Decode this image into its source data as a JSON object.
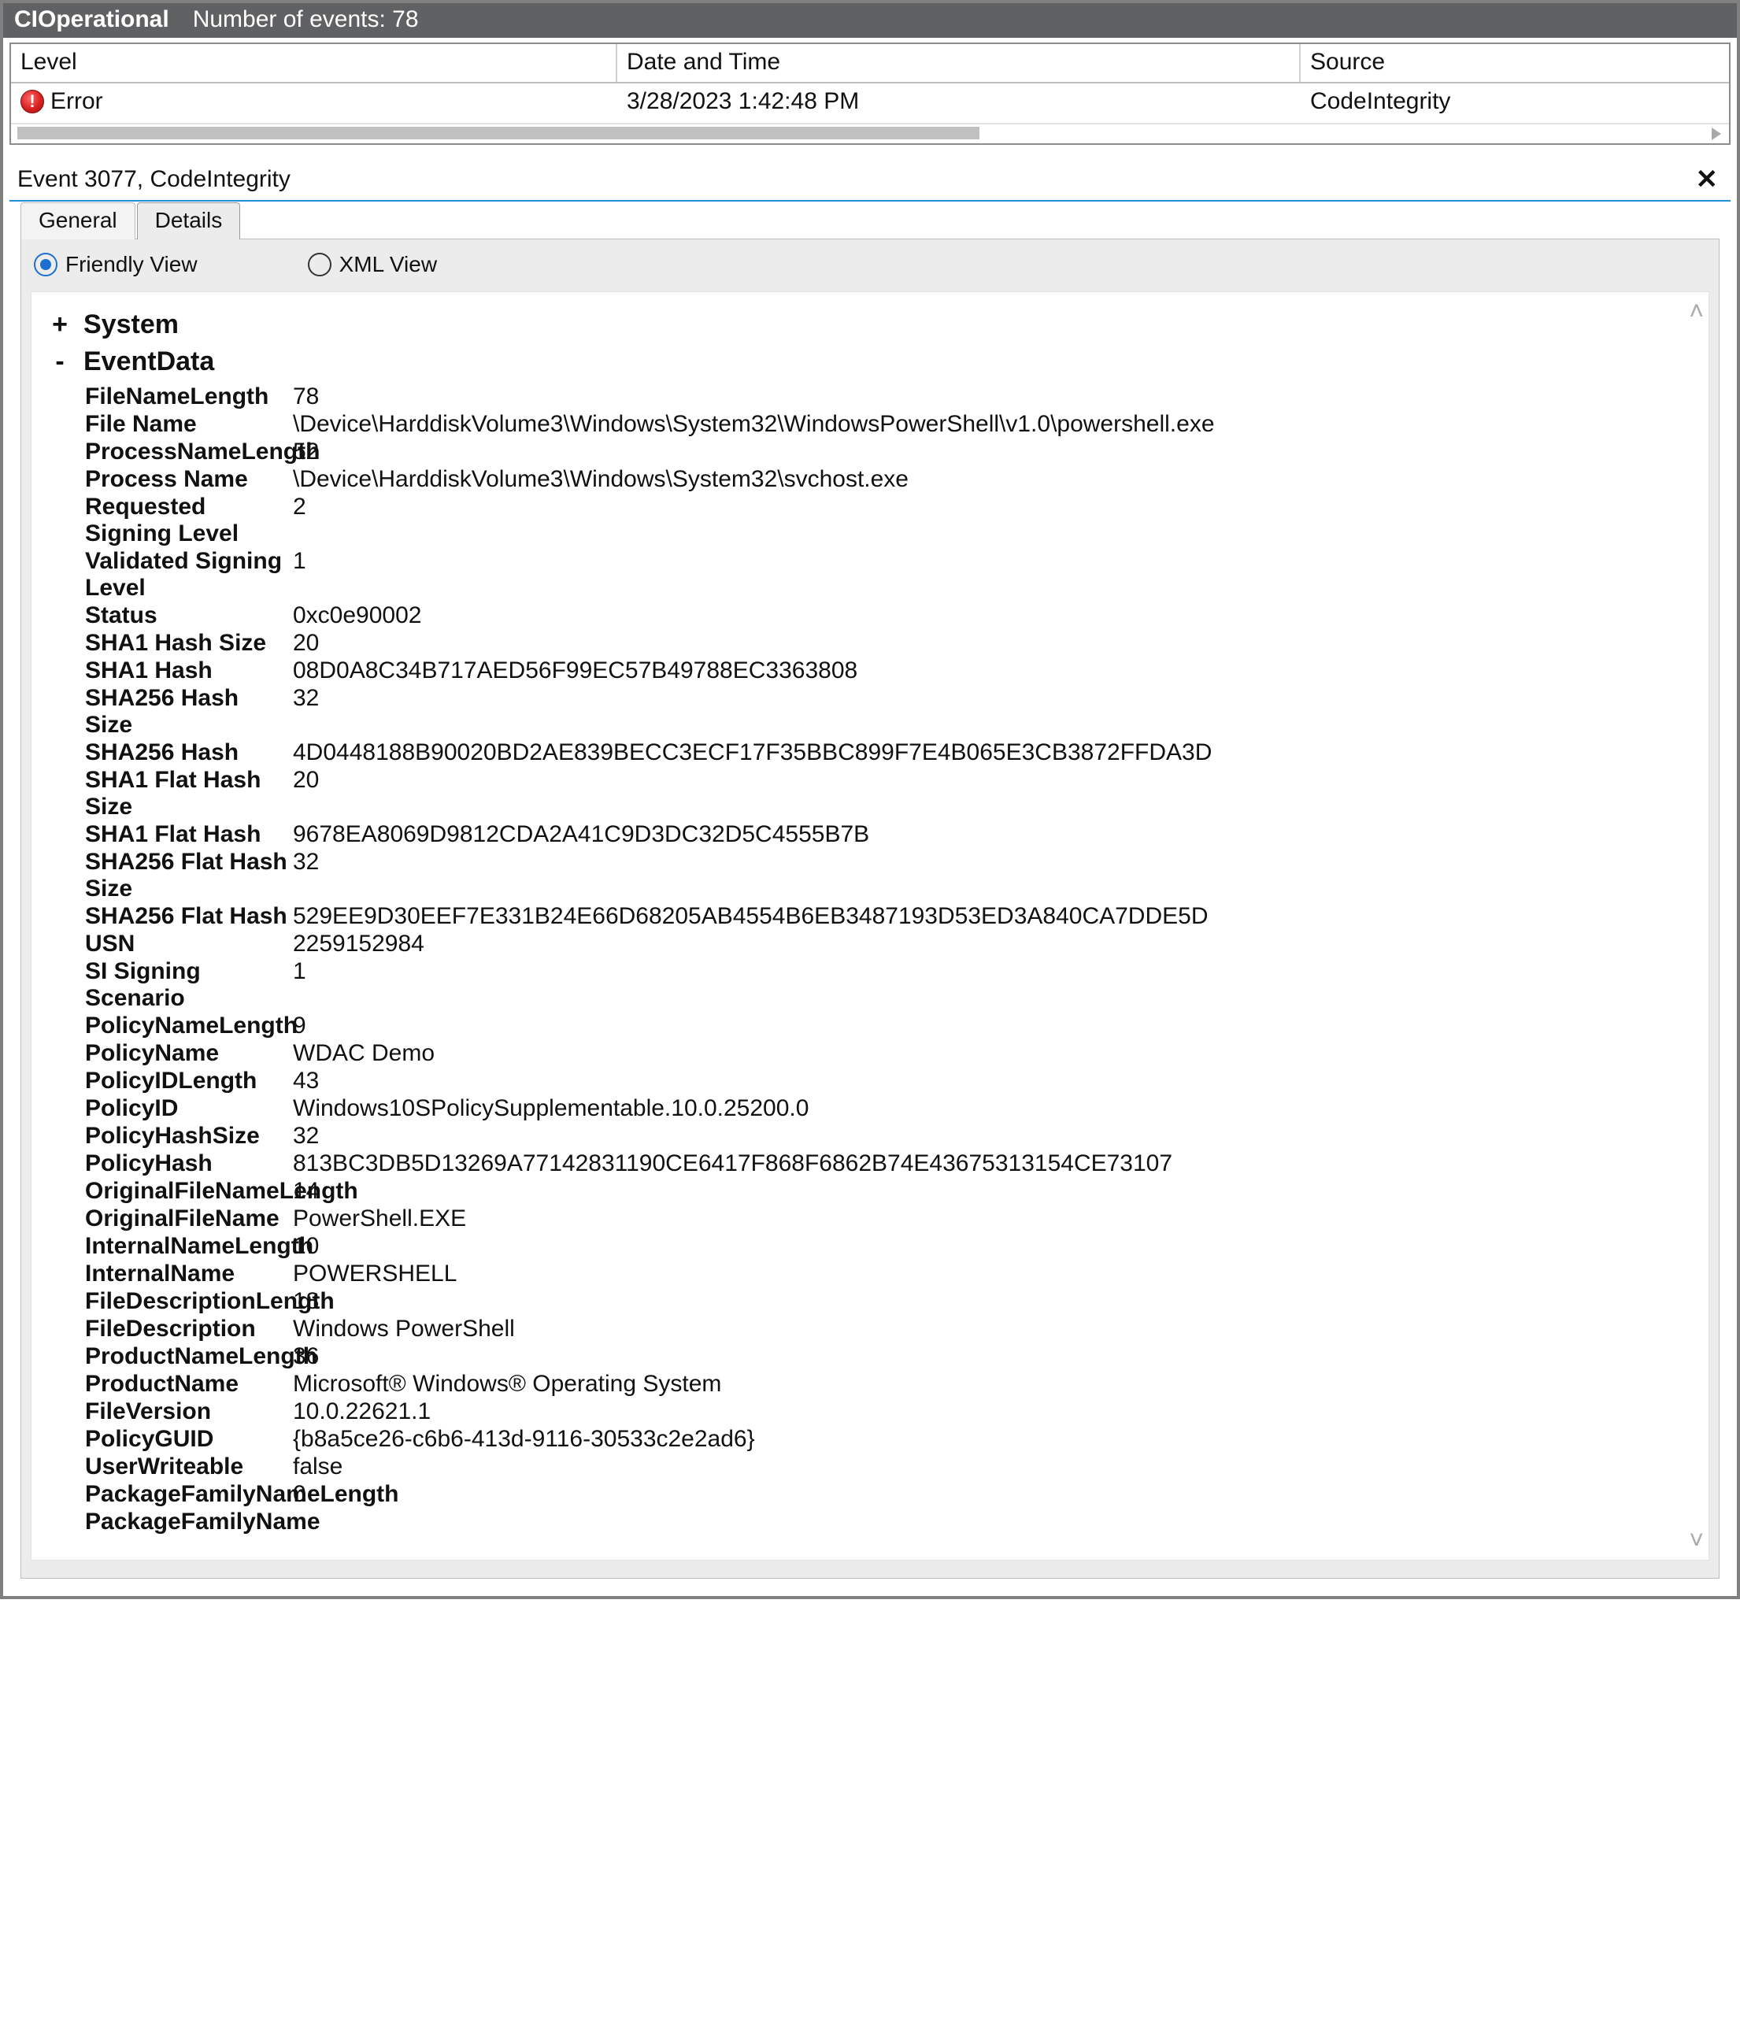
{
  "titlebar": {
    "title": "CIOperational",
    "subtitle": "Number of events: 78"
  },
  "columns": {
    "level": "Level",
    "date": "Date and Time",
    "source": "Source"
  },
  "row": {
    "level": "Error",
    "date": "3/28/2023 1:42:48 PM",
    "source": "CodeIntegrity"
  },
  "event_header": "Event 3077, CodeIntegrity",
  "tabs": {
    "general": "General",
    "details": "Details"
  },
  "viewmodes": {
    "friendly": "Friendly View",
    "xml": "XML View"
  },
  "system_label": "System",
  "eventdata_label": "EventData",
  "fields": [
    {
      "k": "FileNameLength",
      "v": "78"
    },
    {
      "k": "File Name",
      "v": "\\Device\\HarddiskVolume3\\Windows\\System32\\WindowsPowerShell\\v1.0\\powershell.exe"
    },
    {
      "k": "ProcessNameLength",
      "v": "52"
    },
    {
      "k": "Process Name",
      "v": "\\Device\\HarddiskVolume3\\Windows\\System32\\svchost.exe"
    },
    {
      "k": "Requested Signing Level",
      "v": "2"
    },
    {
      "k": "Validated Signing Level",
      "v": "1"
    },
    {
      "k": "Status",
      "v": "0xc0e90002"
    },
    {
      "k": "SHA1 Hash Size",
      "v": "20"
    },
    {
      "k": "SHA1 Hash",
      "v": "08D0A8C34B717AED56F99EC57B49788EC3363808"
    },
    {
      "k": "SHA256 Hash Size",
      "v": "32"
    },
    {
      "k": "SHA256 Hash",
      "v": "4D0448188B90020BD2AE839BECC3ECF17F35BBC899F7E4B065E3CB3872FFDA3D"
    },
    {
      "k": "SHA1 Flat Hash Size",
      "v": "20"
    },
    {
      "k": "SHA1 Flat Hash",
      "v": "9678EA8069D9812CDA2A41C9D3DC32D5C4555B7B"
    },
    {
      "k": "SHA256 Flat Hash Size",
      "v": "32"
    },
    {
      "k": "SHA256 Flat Hash",
      "v": "529EE9D30EEF7E331B24E66D68205AB4554B6EB3487193D53ED3A840CA7DDE5D"
    },
    {
      "k": "USN",
      "v": "2259152984"
    },
    {
      "k": "SI Signing Scenario",
      "v": "1"
    },
    {
      "k": "PolicyNameLength",
      "v": "9"
    },
    {
      "k": "PolicyName",
      "v": "WDAC Demo"
    },
    {
      "k": "PolicyIDLength",
      "v": "43"
    },
    {
      "k": "PolicyID",
      "v": "Windows10SPolicySupplementable.10.0.25200.0"
    },
    {
      "k": "PolicyHashSize",
      "v": "32"
    },
    {
      "k": "PolicyHash",
      "v": "813BC3DB5D13269A77142831190CE6417F868F6862B74E43675313154CE73107"
    },
    {
      "k": "OriginalFileNameLength",
      "v": "14"
    },
    {
      "k": "OriginalFileName",
      "v": "PowerShell.EXE"
    },
    {
      "k": "InternalNameLength",
      "v": "10"
    },
    {
      "k": "InternalName",
      "v": "POWERSHELL"
    },
    {
      "k": "FileDescriptionLength",
      "v": "18"
    },
    {
      "k": "FileDescription",
      "v": "Windows PowerShell"
    },
    {
      "k": "ProductNameLength",
      "v": "36"
    },
    {
      "k": "ProductName",
      "v": "Microsoft® Windows® Operating System"
    },
    {
      "k": "FileVersion",
      "v": "10.0.22621.1"
    },
    {
      "k": "PolicyGUID",
      "v": "{b8a5ce26-c6b6-413d-9116-30533c2e2ad6}"
    },
    {
      "k": "UserWriteable",
      "v": "false"
    },
    {
      "k": "PackageFamilyNameLength",
      "v": "0"
    },
    {
      "k": "PackageFamilyName",
      "v": ""
    }
  ]
}
